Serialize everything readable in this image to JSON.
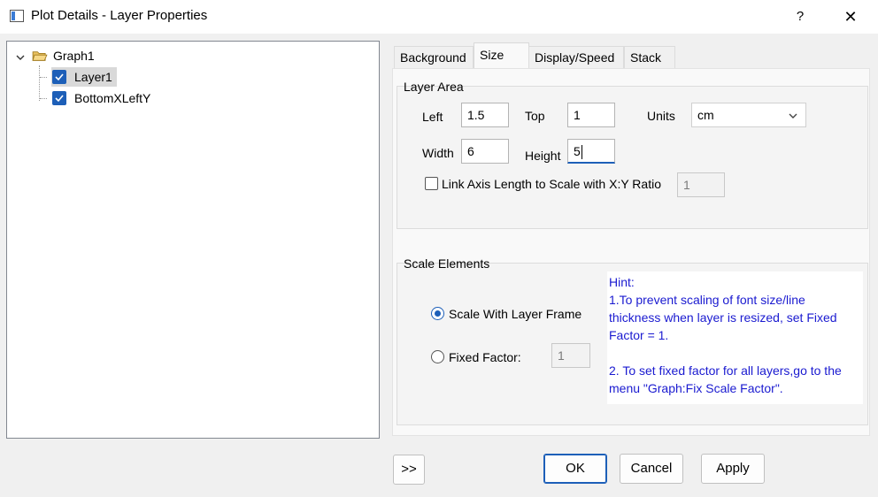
{
  "window": {
    "title": "Plot Details - Layer Properties",
    "help_label": "?",
    "close_label": "✕"
  },
  "tree": {
    "root_label": "Graph1",
    "items": [
      {
        "label": "Layer1",
        "checked": true,
        "selected": true
      },
      {
        "label": "BottomXLeftY",
        "checked": true,
        "selected": false
      }
    ]
  },
  "tabs": [
    {
      "label": "Background",
      "active": false
    },
    {
      "label": "Size",
      "active": true
    },
    {
      "label": "Display/Speed",
      "active": false
    },
    {
      "label": "Stack",
      "active": false
    }
  ],
  "layer_area": {
    "group_label": "Layer Area",
    "left_label": "Left",
    "left_value": "1.5",
    "top_label": "Top",
    "top_value": "1",
    "units_label": "Units",
    "units_value": "cm",
    "width_label": "Width",
    "width_value": "6",
    "height_label": "Height",
    "height_value": "5",
    "link_label": "Link Axis Length to Scale with X:Y Ratio",
    "link_checked": false,
    "ratio_value": "1"
  },
  "scale_elements": {
    "group_label": "Scale Elements",
    "option_frame_label": "Scale With Layer Frame",
    "option_fixed_label": "Fixed Factor:",
    "selected": "frame",
    "fixed_value": "1",
    "hint_title": "Hint:",
    "hint_line1": "1.To prevent scaling of font size/line\nthickness when layer is resized, set Fixed\nFactor = 1.",
    "hint_line2": "2. To set fixed factor for all layers,go to the\nmenu \"Graph:Fix Scale Factor\"."
  },
  "buttons": {
    "expand_label": ">>",
    "ok_label": "OK",
    "cancel_label": "Cancel",
    "apply_label": "Apply"
  },
  "colors": {
    "accent": "#1d5fb8",
    "hint_text": "#1a1ad0"
  }
}
